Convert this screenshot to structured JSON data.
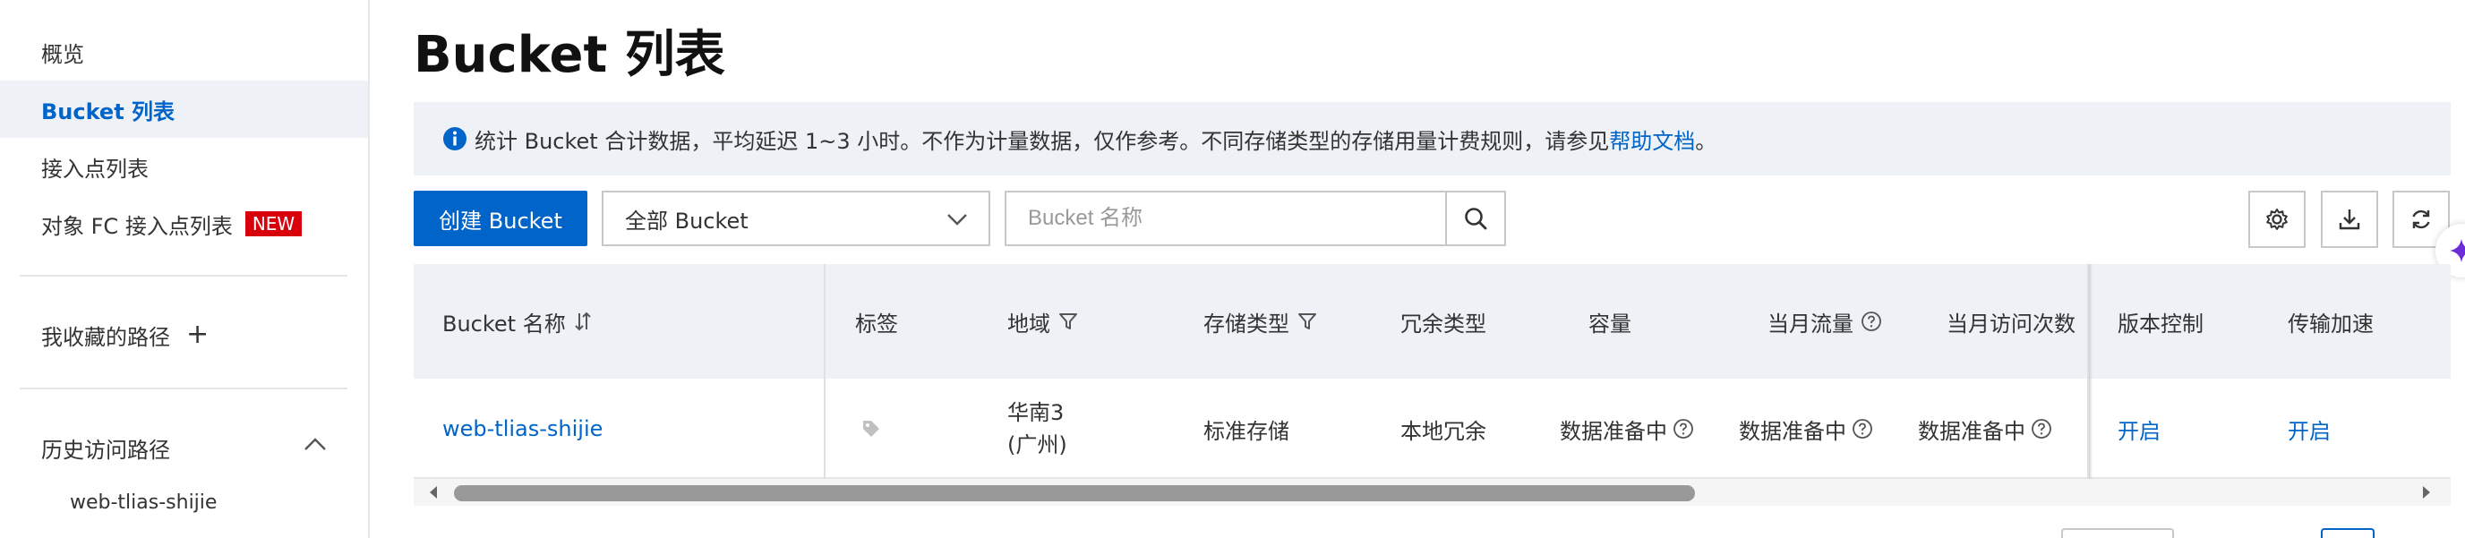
{
  "sidebar": {
    "items": [
      {
        "label": "概览"
      },
      {
        "label": "Bucket 列表"
      },
      {
        "label": "接入点列表"
      },
      {
        "label": "对象 FC 接入点列表",
        "badge": "NEW"
      }
    ],
    "favorites_label": "我收藏的路径",
    "history_label": "历史访问路径",
    "history_items": [
      "web-tlias-shijie"
    ]
  },
  "page_title": "Bucket 列表",
  "notice": {
    "text": "统计 Bucket 合计数据，平均延迟 1~3 小时。不作为计量数据，仅作参考。不同存储类型的存储用量计费规则，请参见",
    "link": "帮助文档",
    "suffix": "。"
  },
  "toolbar": {
    "create_label": "创建 Bucket",
    "filter_value": "全部 Bucket",
    "search_placeholder": "Bucket 名称"
  },
  "table": {
    "headers": {
      "name": "Bucket 名称",
      "tags": "标签",
      "region": "地域",
      "storage": "存储类型",
      "redundancy": "冗余类型",
      "capacity": "容量",
      "traffic": "当月流量",
      "requests": "当月访问次数",
      "versioning": "版本控制",
      "acceleration": "传输加速"
    },
    "rows": [
      {
        "name": "web-tlias-shijie",
        "region_line1": "华南3",
        "region_line2": "(广州)",
        "storage": "标准存储",
        "redundancy": "本地冗余",
        "capacity": "数据准备中",
        "traffic": "数据准备中",
        "requests": "数据准备中",
        "versioning": "开启",
        "acceleration": "开启"
      }
    ]
  },
  "colors": {
    "brand": "#0064c8",
    "new_badge": "#d8000a",
    "header_bg": "#eef1f6"
  }
}
